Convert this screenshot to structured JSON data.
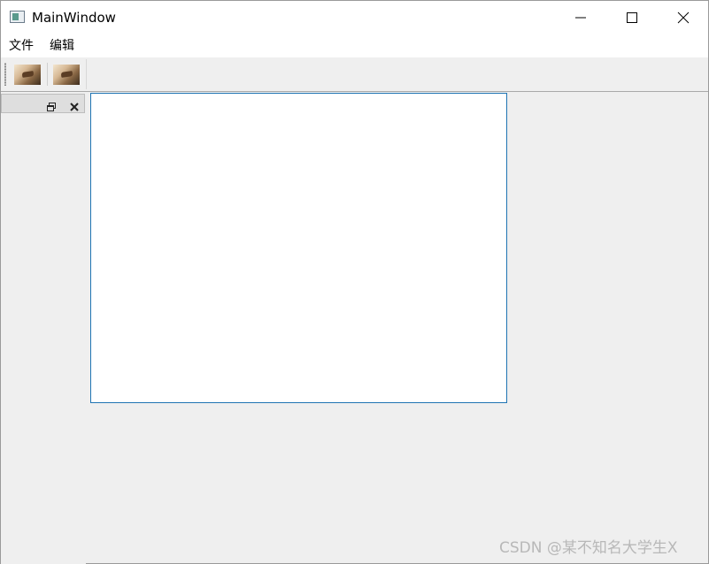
{
  "window": {
    "title": "MainWindow"
  },
  "menubar": {
    "items": [
      {
        "label": "文件"
      },
      {
        "label": "编辑"
      }
    ]
  },
  "toolbar": {
    "buttons": [
      {
        "icon": "image-icon"
      },
      {
        "icon": "image-icon"
      }
    ]
  },
  "dock": {
    "float_icon": "float-icon",
    "close_icon": "close-icon"
  },
  "watermark": {
    "text": "CSDN @某不知名大学生X"
  },
  "colors": {
    "central_border": "#1f74b3",
    "background": "#efefef"
  }
}
